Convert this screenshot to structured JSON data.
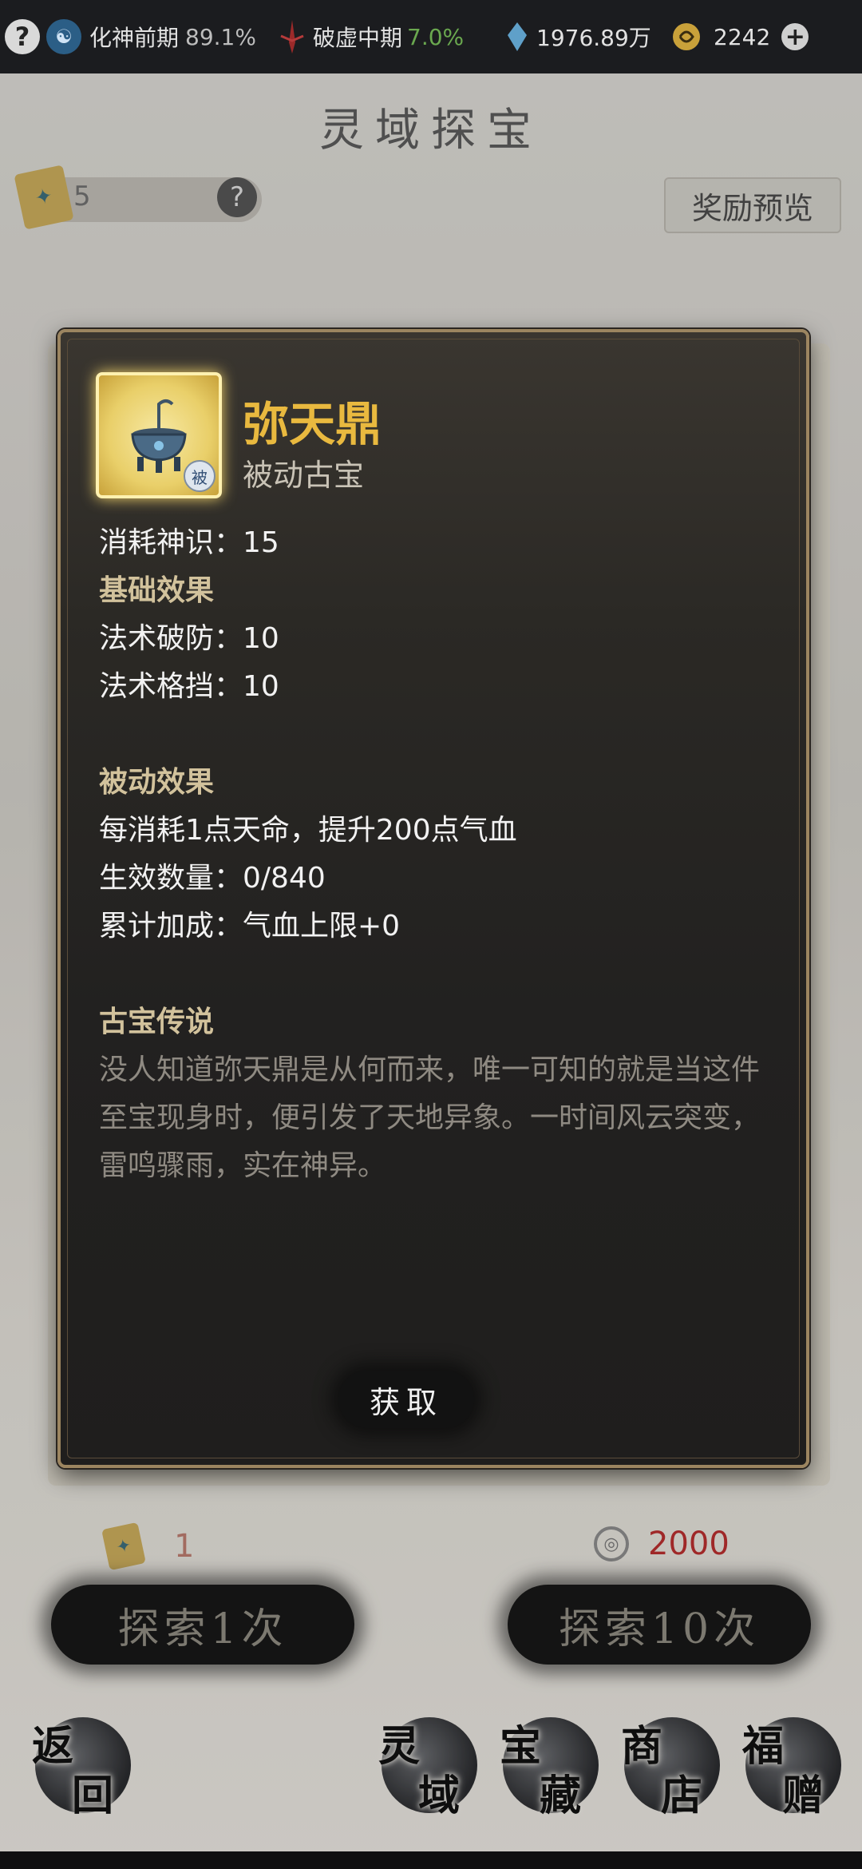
{
  "status_bar": {
    "help_icon": "?",
    "realm_icon": "yin-yang",
    "realm_name": "化神前期",
    "realm_progress": "89.1%",
    "stage_name": "破虚中期",
    "stage_progress": "7.0%",
    "spirit_stone": "1976.89万",
    "currency": "2242",
    "add_icon": "+"
  },
  "page": {
    "title": "灵域探宝",
    "token_count": "5",
    "token_help_icon": "?",
    "reward_preview": "奖励预览"
  },
  "modal": {
    "item_name": "弥天鼎",
    "item_type": "被动古宝",
    "passive_badge": "被",
    "lines": [
      {
        "text": "消耗神识：15",
        "style": "normal"
      },
      {
        "text": "基础效果",
        "style": "head"
      },
      {
        "text": "法术破防：10",
        "style": "normal"
      },
      {
        "text": "法术格挡：10",
        "style": "normal"
      },
      {
        "text": "",
        "style": "blank"
      },
      {
        "text": "被动效果",
        "style": "head"
      },
      {
        "text": "每消耗1点天命，提升200点气血",
        "style": "normal"
      },
      {
        "text": "生效数量：0/840",
        "style": "normal"
      },
      {
        "text": "累计加成：气血上限+0",
        "style": "normal"
      },
      {
        "text": "",
        "style": "blank"
      },
      {
        "text": "古宝传说",
        "style": "head"
      }
    ],
    "lore": "没人知道弥天鼎是从何而来，唯一可知的就是当这件至宝现身时，便引发了天地异象。一时间风云突变，雷鸣骤雨，实在神异。",
    "get_button": "获取"
  },
  "explore": {
    "once_cost": "1",
    "once_label": "探索1次",
    "ten_cost": "2000",
    "ten_label": "探索10次"
  },
  "bottom_nav": {
    "back": [
      "返",
      "回"
    ],
    "lingyu": [
      "灵",
      "域"
    ],
    "baozang": [
      "宝",
      "藏"
    ],
    "shop": [
      "商",
      "店"
    ],
    "gift": [
      "福",
      "赠"
    ]
  }
}
